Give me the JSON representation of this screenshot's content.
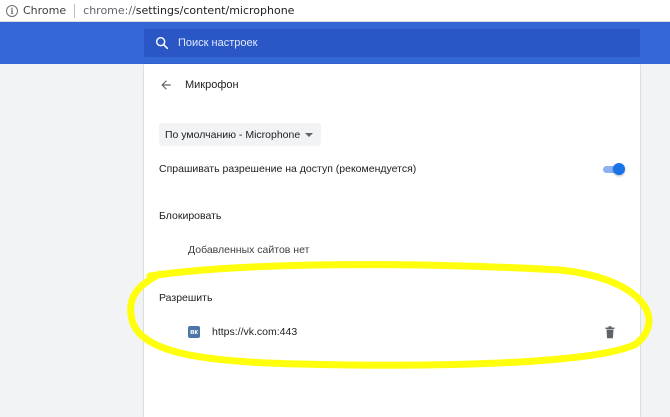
{
  "omnibox": {
    "site_name": "Chrome",
    "url_scheme": "chrome://",
    "url_path": "settings/content/microphone"
  },
  "search": {
    "placeholder": "Поиск настроек"
  },
  "page": {
    "title": "Микрофон",
    "device_select": "По умолчанию - Microphone",
    "ask_label": "Спрашивать разрешение на доступ (рекомендуется)",
    "ask_enabled": true,
    "block_label": "Блокировать",
    "block_empty": "Добавленных сайтов нет",
    "allow_label": "Разрешить",
    "allowed_sites": [
      {
        "icon": "vk-icon",
        "url": "https://vk.com:443"
      }
    ]
  },
  "colors": {
    "toolbar": "#3367d6",
    "search_field": "#2a56c6",
    "toggle_on": "#1a73e8",
    "highlight": "#ffff00"
  }
}
